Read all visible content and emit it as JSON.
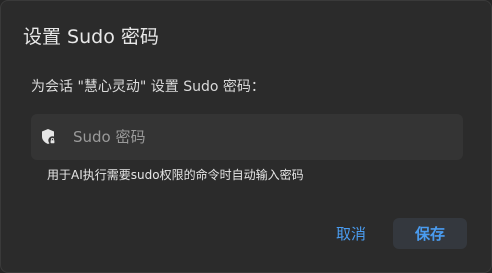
{
  "dialog": {
    "title": "设置 Sudo 密码",
    "prompt": "为会话 \"慧心灵动\" 设置 Sudo 密码：",
    "password_field": {
      "placeholder": "Sudo 密码",
      "value": "",
      "icon": "shield-lock-icon"
    },
    "hint": "用于AI执行需要sudo权限的命令时自动输入密码",
    "cancel_label": "取消",
    "save_label": "保存"
  },
  "colors": {
    "background": "#2b2b2b",
    "field_background": "#343434",
    "accent": "#4a9cf0",
    "save_button_background": "#34383e"
  }
}
